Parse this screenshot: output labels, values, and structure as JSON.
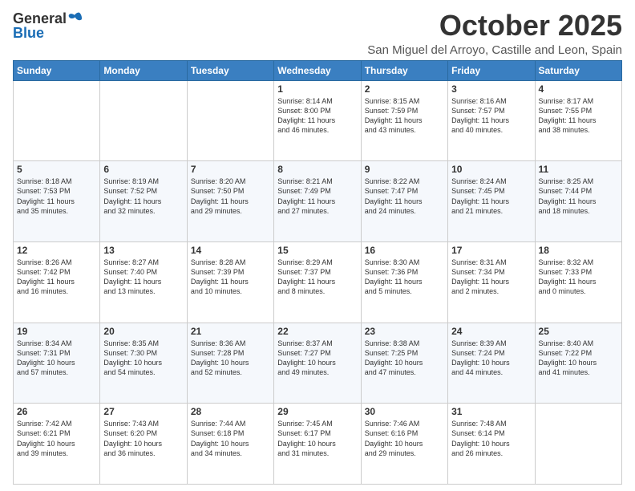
{
  "logo": {
    "general": "General",
    "blue": "Blue"
  },
  "title": "October 2025",
  "location": "San Miguel del Arroyo, Castille and Leon, Spain",
  "weekdays": [
    "Sunday",
    "Monday",
    "Tuesday",
    "Wednesday",
    "Thursday",
    "Friday",
    "Saturday"
  ],
  "weeks": [
    [
      {
        "day": "",
        "info": ""
      },
      {
        "day": "",
        "info": ""
      },
      {
        "day": "",
        "info": ""
      },
      {
        "day": "1",
        "info": "Sunrise: 8:14 AM\nSunset: 8:00 PM\nDaylight: 11 hours\nand 46 minutes."
      },
      {
        "day": "2",
        "info": "Sunrise: 8:15 AM\nSunset: 7:59 PM\nDaylight: 11 hours\nand 43 minutes."
      },
      {
        "day": "3",
        "info": "Sunrise: 8:16 AM\nSunset: 7:57 PM\nDaylight: 11 hours\nand 40 minutes."
      },
      {
        "day": "4",
        "info": "Sunrise: 8:17 AM\nSunset: 7:55 PM\nDaylight: 11 hours\nand 38 minutes."
      }
    ],
    [
      {
        "day": "5",
        "info": "Sunrise: 8:18 AM\nSunset: 7:53 PM\nDaylight: 11 hours\nand 35 minutes."
      },
      {
        "day": "6",
        "info": "Sunrise: 8:19 AM\nSunset: 7:52 PM\nDaylight: 11 hours\nand 32 minutes."
      },
      {
        "day": "7",
        "info": "Sunrise: 8:20 AM\nSunset: 7:50 PM\nDaylight: 11 hours\nand 29 minutes."
      },
      {
        "day": "8",
        "info": "Sunrise: 8:21 AM\nSunset: 7:49 PM\nDaylight: 11 hours\nand 27 minutes."
      },
      {
        "day": "9",
        "info": "Sunrise: 8:22 AM\nSunset: 7:47 PM\nDaylight: 11 hours\nand 24 minutes."
      },
      {
        "day": "10",
        "info": "Sunrise: 8:24 AM\nSunset: 7:45 PM\nDaylight: 11 hours\nand 21 minutes."
      },
      {
        "day": "11",
        "info": "Sunrise: 8:25 AM\nSunset: 7:44 PM\nDaylight: 11 hours\nand 18 minutes."
      }
    ],
    [
      {
        "day": "12",
        "info": "Sunrise: 8:26 AM\nSunset: 7:42 PM\nDaylight: 11 hours\nand 16 minutes."
      },
      {
        "day": "13",
        "info": "Sunrise: 8:27 AM\nSunset: 7:40 PM\nDaylight: 11 hours\nand 13 minutes."
      },
      {
        "day": "14",
        "info": "Sunrise: 8:28 AM\nSunset: 7:39 PM\nDaylight: 11 hours\nand 10 minutes."
      },
      {
        "day": "15",
        "info": "Sunrise: 8:29 AM\nSunset: 7:37 PM\nDaylight: 11 hours\nand 8 minutes."
      },
      {
        "day": "16",
        "info": "Sunrise: 8:30 AM\nSunset: 7:36 PM\nDaylight: 11 hours\nand 5 minutes."
      },
      {
        "day": "17",
        "info": "Sunrise: 8:31 AM\nSunset: 7:34 PM\nDaylight: 11 hours\nand 2 minutes."
      },
      {
        "day": "18",
        "info": "Sunrise: 8:32 AM\nSunset: 7:33 PM\nDaylight: 11 hours\nand 0 minutes."
      }
    ],
    [
      {
        "day": "19",
        "info": "Sunrise: 8:34 AM\nSunset: 7:31 PM\nDaylight: 10 hours\nand 57 minutes."
      },
      {
        "day": "20",
        "info": "Sunrise: 8:35 AM\nSunset: 7:30 PM\nDaylight: 10 hours\nand 54 minutes."
      },
      {
        "day": "21",
        "info": "Sunrise: 8:36 AM\nSunset: 7:28 PM\nDaylight: 10 hours\nand 52 minutes."
      },
      {
        "day": "22",
        "info": "Sunrise: 8:37 AM\nSunset: 7:27 PM\nDaylight: 10 hours\nand 49 minutes."
      },
      {
        "day": "23",
        "info": "Sunrise: 8:38 AM\nSunset: 7:25 PM\nDaylight: 10 hours\nand 47 minutes."
      },
      {
        "day": "24",
        "info": "Sunrise: 8:39 AM\nSunset: 7:24 PM\nDaylight: 10 hours\nand 44 minutes."
      },
      {
        "day": "25",
        "info": "Sunrise: 8:40 AM\nSunset: 7:22 PM\nDaylight: 10 hours\nand 41 minutes."
      }
    ],
    [
      {
        "day": "26",
        "info": "Sunrise: 7:42 AM\nSunset: 6:21 PM\nDaylight: 10 hours\nand 39 minutes."
      },
      {
        "day": "27",
        "info": "Sunrise: 7:43 AM\nSunset: 6:20 PM\nDaylight: 10 hours\nand 36 minutes."
      },
      {
        "day": "28",
        "info": "Sunrise: 7:44 AM\nSunset: 6:18 PM\nDaylight: 10 hours\nand 34 minutes."
      },
      {
        "day": "29",
        "info": "Sunrise: 7:45 AM\nSunset: 6:17 PM\nDaylight: 10 hours\nand 31 minutes."
      },
      {
        "day": "30",
        "info": "Sunrise: 7:46 AM\nSunset: 6:16 PM\nDaylight: 10 hours\nand 29 minutes."
      },
      {
        "day": "31",
        "info": "Sunrise: 7:48 AM\nSunset: 6:14 PM\nDaylight: 10 hours\nand 26 minutes."
      },
      {
        "day": "",
        "info": ""
      }
    ]
  ]
}
